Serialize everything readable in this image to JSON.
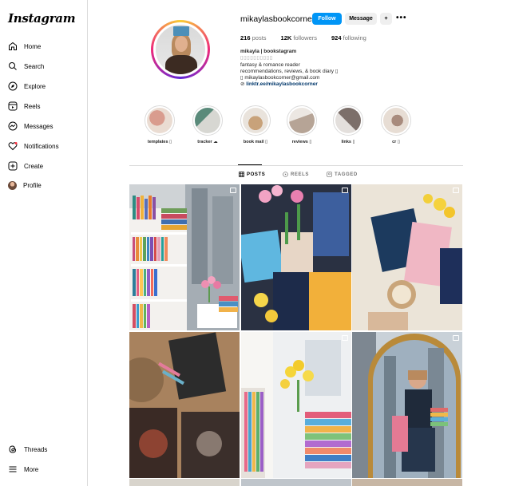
{
  "sidebar": {
    "logo": "Instagram",
    "items": [
      {
        "label": "Home",
        "icon": "home-icon"
      },
      {
        "label": "Search",
        "icon": "search-icon"
      },
      {
        "label": "Explore",
        "icon": "compass-icon"
      },
      {
        "label": "Reels",
        "icon": "reels-icon"
      },
      {
        "label": "Messages",
        "icon": "messenger-icon"
      },
      {
        "label": "Notifications",
        "icon": "heart-icon"
      },
      {
        "label": "Create",
        "icon": "plus-square-icon"
      },
      {
        "label": "Profile",
        "icon": "avatar"
      }
    ],
    "bottom": [
      {
        "label": "Threads",
        "icon": "threads-icon"
      },
      {
        "label": "More",
        "icon": "menu-icon"
      }
    ]
  },
  "profile": {
    "username": "mikaylasbookcorner",
    "follow_label": "Follow",
    "message_label": "Message",
    "add_user_label": "+",
    "more_label": "•••",
    "stats": {
      "posts_count": "216",
      "posts_label": "posts",
      "followers_count": "12K",
      "followers_label": "followers",
      "following_count": "924",
      "following_label": "following"
    },
    "bio": {
      "name": "mikayla | bookstagram",
      "pronouns": "▯▯▯▯▯▯▯▯▯▯",
      "line1": "fantasy & romance reader",
      "line2": "recommendations, reviews, & book diary ▯",
      "email": "▯ mikaylasbookcorner@gmail.com",
      "link_prefix": "⊘",
      "link": "linktr.ee/mikaylasbookcorner"
    }
  },
  "highlights": [
    {
      "label": "templates ▯",
      "colors": [
        "#d99c8e",
        "#eadcd2"
      ]
    },
    {
      "label": "tracker ☁",
      "colors": [
        "#5a8a7a",
        "#d7d7d2"
      ]
    },
    {
      "label": "book mail ▯",
      "colors": [
        "#c8a27a",
        "#e9e3dc"
      ]
    },
    {
      "label": "reviews ▯",
      "colors": [
        "#b6a496",
        "#ece7e2"
      ]
    },
    {
      "label": "links ▯",
      "colors": [
        "#7c6f6a",
        "#e3dfdc"
      ]
    },
    {
      "label": "cr ▯",
      "colors": [
        "#a88b7d",
        "#e7ddd4"
      ]
    }
  ],
  "tabs": [
    {
      "label": "POSTS",
      "icon": "grid-icon",
      "active": true
    },
    {
      "label": "REELS",
      "icon": "reels-icon",
      "active": false
    },
    {
      "label": "TAGGED",
      "icon": "tag-icon",
      "active": false
    }
  ],
  "colors": {
    "accent": "#0095f6",
    "link": "#00376b",
    "border": "#dbdbdb"
  }
}
